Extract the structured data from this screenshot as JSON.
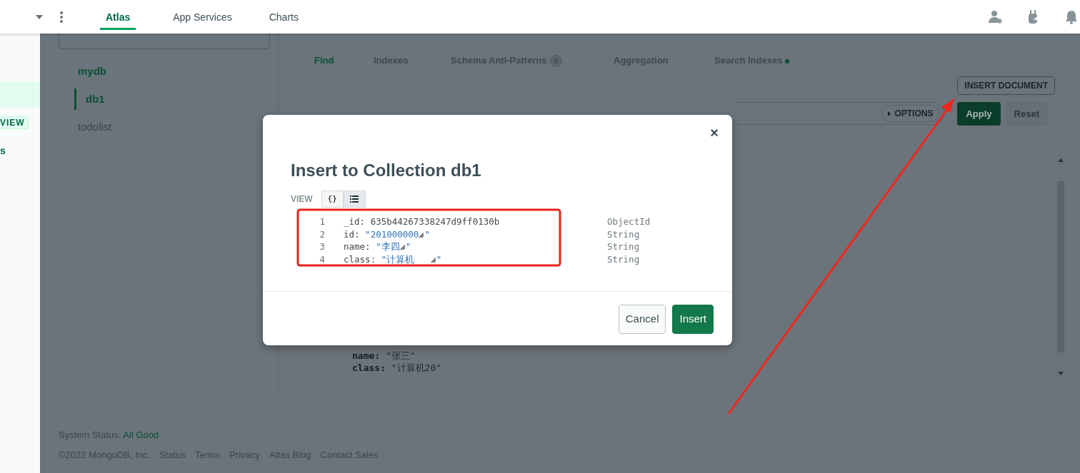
{
  "header": {
    "tabs": [
      {
        "label": "Atlas",
        "selected": true
      },
      {
        "label": "App Services",
        "selected": false
      },
      {
        "label": "Charts",
        "selected": false
      }
    ]
  },
  "left_nav": {
    "items": [
      {
        "kind": "badge",
        "label": "VIEW"
      },
      {
        "kind": "link",
        "label": "s"
      }
    ]
  },
  "sidebar": {
    "tree": [
      {
        "label": "mydb",
        "selected": true,
        "children": [
          {
            "label": "db1",
            "selected": true
          }
        ]
      },
      {
        "label": "todolist",
        "selected": false
      }
    ]
  },
  "collection_tabs": [
    {
      "label": "Find",
      "selected": true
    },
    {
      "label": "Indexes",
      "selected": false
    },
    {
      "label": "Schema Anti-Patterns",
      "selected": false,
      "count": "0"
    },
    {
      "label": "Aggregation",
      "selected": false
    },
    {
      "label": "Search Indexes",
      "selected": false,
      "dot": true
    }
  ],
  "toolbar": {
    "insert_button": "INSERT DOCUMENT",
    "options_button": "OPTIONS",
    "apply_button": {
      "label": "Apply",
      "disabled": false
    },
    "reset_button": {
      "label": "Reset",
      "disabled": true
    }
  },
  "document": {
    "lines": [
      {
        "key": "name:",
        "value": "\"张三\""
      },
      {
        "key": "class:",
        "value": "\"计算机20\""
      }
    ]
  },
  "footer": {
    "status_label": "System Status:",
    "status_value": "All Good",
    "copyright": "©2022 MongoDB, Inc.",
    "links": [
      "Status",
      "Terms",
      "Privacy",
      "Atlas Blog",
      "Contact Sales"
    ]
  },
  "modal": {
    "title": "Insert to Collection db1",
    "close": "×",
    "view_label": "VIEW",
    "view_toggle": [
      {
        "kind": "json",
        "label": "{}",
        "selected": false
      },
      {
        "kind": "list",
        "selected": true
      }
    ],
    "fields": [
      {
        "line": "1",
        "key": "_id:",
        "kind": "plain",
        "value": "635b44267338247d9ff0130b",
        "type": "ObjectId"
      },
      {
        "line": "2",
        "key": "id:",
        "kind": "string",
        "value": "\"201000000",
        "closing": "\"",
        "type": "String"
      },
      {
        "line": "3",
        "key": "name:",
        "kind": "string",
        "value": "\"李四",
        "closing": "\"",
        "type": "String"
      },
      {
        "line": "4",
        "key": "class:",
        "kind": "string",
        "value": "\"计算机   ",
        "closing": "\"",
        "type": "String"
      }
    ],
    "buttons": [
      {
        "kind": "secondary",
        "label": "Cancel"
      },
      {
        "kind": "primary",
        "label": "Insert"
      }
    ]
  }
}
